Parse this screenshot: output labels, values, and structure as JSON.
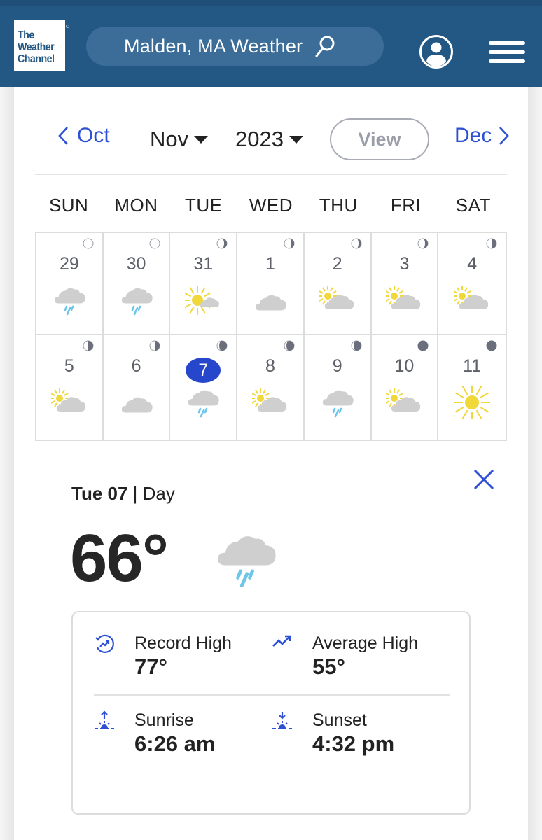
{
  "header": {
    "logo_lines": [
      "The",
      "Weather",
      "Channel"
    ],
    "search_label": "Malden, MA Weather",
    "icons": {
      "search": "search-icon",
      "account": "account-icon",
      "menu": "hamburger-menu-icon"
    }
  },
  "calendar": {
    "prev_month_label": "Oct",
    "next_month_label": "Dec",
    "month_select": "Nov",
    "year_select": "2023",
    "view_button": "View",
    "weekdays": [
      "SUN",
      "MON",
      "TUE",
      "WED",
      "THU",
      "FRI",
      "SAT"
    ],
    "days": [
      {
        "day": "29",
        "moon": "full",
        "weather": "rain"
      },
      {
        "day": "30",
        "moon": "full",
        "weather": "rain"
      },
      {
        "day": "31",
        "moon": "waning-gibbous",
        "weather": "mostly-sunny"
      },
      {
        "day": "1",
        "moon": "waning-gibbous",
        "weather": "cloudy"
      },
      {
        "day": "2",
        "moon": "waning-gibbous",
        "weather": "partly-cloudy"
      },
      {
        "day": "3",
        "moon": "waning-gibbous",
        "weather": "partly-cloudy"
      },
      {
        "day": "4",
        "moon": "last-quarter",
        "weather": "partly-cloudy"
      },
      {
        "day": "5",
        "moon": "last-quarter",
        "weather": "partly-cloudy"
      },
      {
        "day": "6",
        "moon": "last-quarter",
        "weather": "cloudy"
      },
      {
        "day": "7",
        "moon": "waning-crescent",
        "weather": "rain",
        "selected": true
      },
      {
        "day": "8",
        "moon": "waning-crescent",
        "weather": "partly-cloudy"
      },
      {
        "day": "9",
        "moon": "waning-crescent",
        "weather": "rain"
      },
      {
        "day": "10",
        "moon": "new",
        "weather": "partly-cloudy"
      },
      {
        "day": "11",
        "moon": "new",
        "weather": "sunny"
      }
    ]
  },
  "detail": {
    "date_bold": "Tue 07",
    "separator": " | ",
    "period": "Day",
    "temperature": "66°",
    "weather": "rain",
    "close_icon": "close-icon",
    "stats": [
      {
        "icon": "record-high-icon",
        "label": "Record High",
        "value": "77°"
      },
      {
        "icon": "average-high-icon",
        "label": "Average High",
        "value": "55°"
      },
      {
        "icon": "sunrise-icon",
        "label": "Sunrise",
        "value": "6:26 am"
      },
      {
        "icon": "sunset-icon",
        "label": "Sunset",
        "value": "4:32 pm"
      }
    ]
  },
  "colors": {
    "header_bg": "#245884",
    "accent_blue": "#2d50d6",
    "selected_day": "#2646cc",
    "rain": "#6cc6ea",
    "cloud": "#cfcfcf",
    "sun": "#f0d83a",
    "moon_dark": "#6b6f7c"
  }
}
